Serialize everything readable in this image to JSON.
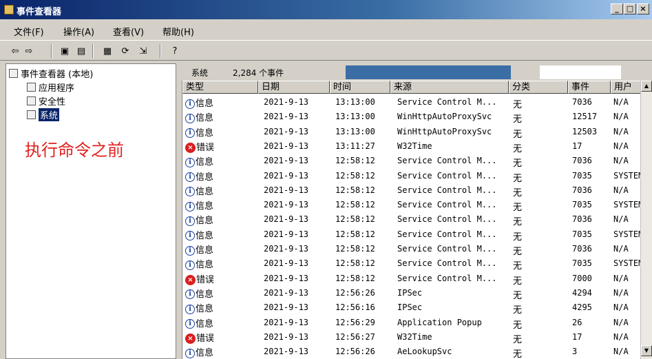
{
  "window": {
    "title": "事件查看器"
  },
  "menu": [
    "文件(F)",
    "操作(A)",
    "查看(V)",
    "帮助(H)"
  ],
  "tree": {
    "root": "事件查看器 (本地)",
    "items": [
      "应用程序",
      "安全性",
      "系统"
    ],
    "selected": "系统"
  },
  "annotation": "执行命令之前",
  "status": {
    "log": "系统",
    "count": "2,284 个事件"
  },
  "columns": [
    "类型",
    "日期",
    "时间",
    "来源",
    "分类",
    "事件",
    "用户"
  ],
  "rows": [
    {
      "type": "信息",
      "kind": "info",
      "date": "2021-9-13",
      "time": "13:13:00",
      "source": "Service Control M...",
      "category": "无",
      "event": "7036",
      "user": "N/A"
    },
    {
      "type": "信息",
      "kind": "info",
      "date": "2021-9-13",
      "time": "13:13:00",
      "source": "WinHttpAutoProxySvc",
      "category": "无",
      "event": "12517",
      "user": "N/A"
    },
    {
      "type": "信息",
      "kind": "info",
      "date": "2021-9-13",
      "time": "13:13:00",
      "source": "WinHttpAutoProxySvc",
      "category": "无",
      "event": "12503",
      "user": "N/A"
    },
    {
      "type": "错误",
      "kind": "error",
      "date": "2021-9-13",
      "time": "13:11:27",
      "source": "W32Time",
      "category": "无",
      "event": "17",
      "user": "N/A"
    },
    {
      "type": "信息",
      "kind": "info",
      "date": "2021-9-13",
      "time": "12:58:12",
      "source": "Service Control M...",
      "category": "无",
      "event": "7036",
      "user": "N/A"
    },
    {
      "type": "信息",
      "kind": "info",
      "date": "2021-9-13",
      "time": "12:58:12",
      "source": "Service Control M...",
      "category": "无",
      "event": "7035",
      "user": "SYSTEM"
    },
    {
      "type": "信息",
      "kind": "info",
      "date": "2021-9-13",
      "time": "12:58:12",
      "source": "Service Control M...",
      "category": "无",
      "event": "7036",
      "user": "N/A"
    },
    {
      "type": "信息",
      "kind": "info",
      "date": "2021-9-13",
      "time": "12:58:12",
      "source": "Service Control M...",
      "category": "无",
      "event": "7035",
      "user": "SYSTEM"
    },
    {
      "type": "信息",
      "kind": "info",
      "date": "2021-9-13",
      "time": "12:58:12",
      "source": "Service Control M...",
      "category": "无",
      "event": "7036",
      "user": "N/A"
    },
    {
      "type": "信息",
      "kind": "info",
      "date": "2021-9-13",
      "time": "12:58:12",
      "source": "Service Control M...",
      "category": "无",
      "event": "7035",
      "user": "SYSTEM"
    },
    {
      "type": "信息",
      "kind": "info",
      "date": "2021-9-13",
      "time": "12:58:12",
      "source": "Service Control M...",
      "category": "无",
      "event": "7036",
      "user": "N/A"
    },
    {
      "type": "信息",
      "kind": "info",
      "date": "2021-9-13",
      "time": "12:58:12",
      "source": "Service Control M...",
      "category": "无",
      "event": "7035",
      "user": "SYSTEM"
    },
    {
      "type": "错误",
      "kind": "error",
      "date": "2021-9-13",
      "time": "12:58:12",
      "source": "Service Control M...",
      "category": "无",
      "event": "7000",
      "user": "N/A"
    },
    {
      "type": "信息",
      "kind": "info",
      "date": "2021-9-13",
      "time": "12:56:26",
      "source": "IPSec",
      "category": "无",
      "event": "4294",
      "user": "N/A"
    },
    {
      "type": "信息",
      "kind": "info",
      "date": "2021-9-13",
      "time": "12:56:16",
      "source": "IPSec",
      "category": "无",
      "event": "4295",
      "user": "N/A"
    },
    {
      "type": "信息",
      "kind": "info",
      "date": "2021-9-13",
      "time": "12:56:29",
      "source": "Application Popup",
      "category": "无",
      "event": "26",
      "user": "N/A"
    },
    {
      "type": "错误",
      "kind": "error",
      "date": "2021-9-13",
      "time": "12:56:27",
      "source": "W32Time",
      "category": "无",
      "event": "17",
      "user": "N/A"
    },
    {
      "type": "信息",
      "kind": "info",
      "date": "2021-9-13",
      "time": "12:56:26",
      "source": "AeLookupSvc",
      "category": "无",
      "event": "3",
      "user": "N/A"
    }
  ]
}
